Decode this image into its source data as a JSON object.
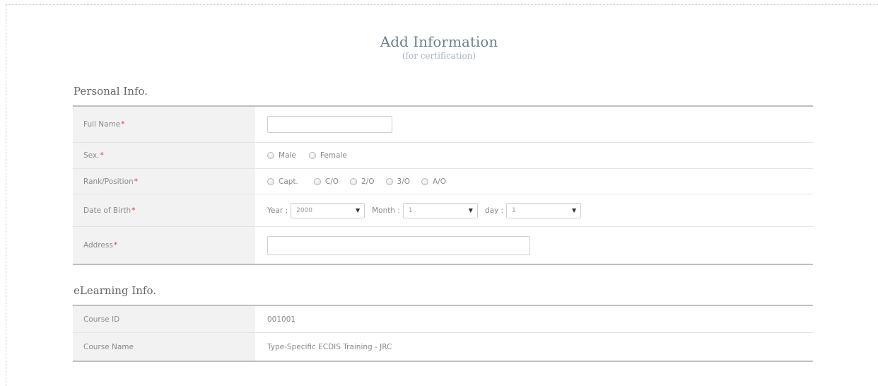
{
  "header": {
    "title": "Add Information",
    "subtitle": "(for certification)"
  },
  "personal": {
    "heading": "Personal Info.",
    "full_name": {
      "label": "Full Name",
      "required": "*",
      "value": ""
    },
    "sex": {
      "label": "Sex.",
      "required": "*",
      "options": [
        "Male",
        "Female"
      ]
    },
    "rank": {
      "label": "Rank/Position",
      "required": "*",
      "options": [
        "Capt.",
        "C/O",
        "2/O",
        "3/O",
        "A/O"
      ]
    },
    "dob": {
      "label": "Date of Birth",
      "required": "*",
      "year_label": "Year :",
      "year_value": "2000",
      "month_label": "Month :",
      "month_value": "1",
      "day_label": "day :",
      "day_value": "1"
    },
    "address": {
      "label": "Address",
      "required": "*",
      "value": ""
    }
  },
  "elearning": {
    "heading": "eLearning Info.",
    "course_id_label": "Course ID",
    "course_id": "001001",
    "course_name_label": "Course Name",
    "course_name": "Type-Specific ECDIS Training - JRC"
  },
  "colors": {
    "required": "#e2342f",
    "label_bg": "#f2f2f2",
    "title": "#6b7f90"
  },
  "icons": {
    "radio": "radio-circle",
    "select_caret": "triangle-down"
  }
}
